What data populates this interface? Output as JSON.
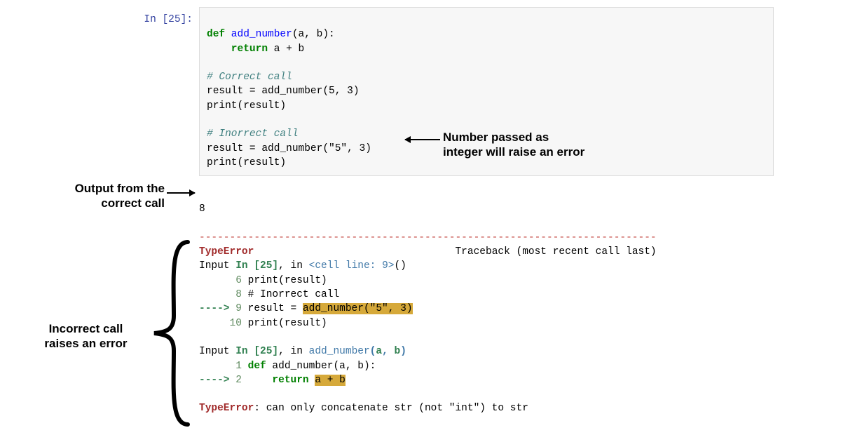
{
  "prompt": "In [25]:",
  "code": {
    "l1": {
      "def": "def",
      "fn": " add_number",
      "rest": "(a, b):"
    },
    "l2": {
      "ret": "    return",
      "rest": " a + b"
    },
    "blank1": "",
    "l3_comment": "# Correct call",
    "l4": "result = add_number(5, 3)",
    "l5": "print(result)",
    "blank2": "",
    "l6_comment": "# Inorrect call",
    "l7": "result = add_number(\"5\", 3)",
    "l8": "print(result)"
  },
  "output": {
    "val": "8",
    "sep": "---------------------------------------------------------------------------",
    "err_name": "TypeError",
    "err_tb_label": "Traceback (most recent call last)",
    "tb1_pre": "Input ",
    "tb1_in": "In [25]",
    "tb1_post": ", in ",
    "tb1_loc": "<cell line: 9>",
    "tb1_end": "()",
    "l6": {
      "n": "      6",
      "t": " print(result)"
    },
    "l8": {
      "n": "      8",
      "t": " # Inorrect call"
    },
    "l9": {
      "arrow": "----> ",
      "n": "9",
      "pre": " result = ",
      "hl": "add_number(\"5\", 3)"
    },
    "l10": {
      "n": "     10",
      "t": " print(result)"
    },
    "tb2_pre": "Input ",
    "tb2_in": "In [25]",
    "tb2_post": ", in ",
    "tb2_fn": "add_number",
    "tb2_open": "(",
    "tb2_a": "a",
    "tb2_c": ", ",
    "tb2_b": "b",
    "tb2_close": ")",
    "f1": {
      "n": "      1",
      "def": " def",
      "rest": " add_number(a, b):"
    },
    "f2": {
      "arrow": "----> ",
      "n": "2",
      "ret": "     return",
      "pre": " ",
      "hl": "a + b"
    },
    "final_name": "TypeError",
    "final_msg": ": can only concatenate str (not \"int\") to str"
  },
  "annot": {
    "a1": "Output from the correct call",
    "a2_l1": "Number passed as",
    "a2_l2": "integer will raise an error",
    "a3_l1": "Incorrect call",
    "a3_l2": "raises an error"
  }
}
